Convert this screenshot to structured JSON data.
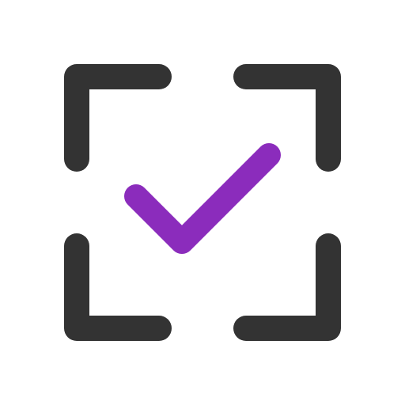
{
  "icon": {
    "name": "scan-check-icon",
    "frame_color": "#333333",
    "check_color": "#8b2cbc",
    "background_color": "#ffffff"
  }
}
